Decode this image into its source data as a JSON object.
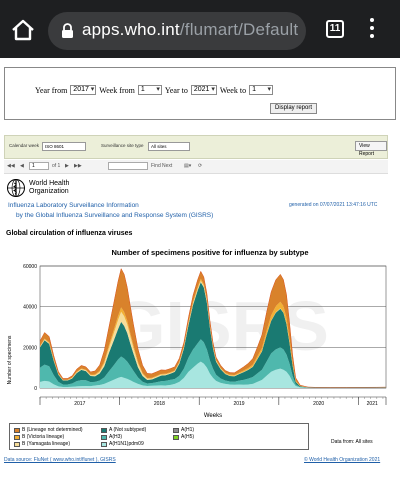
{
  "browser": {
    "url_host": "apps.who.int",
    "url_path": "/flumart/Default",
    "tab_count": "11"
  },
  "filters": {
    "year_from_label": "Year from",
    "year_from_value": "2017",
    "week_from_label": "Week from",
    "week_from_value": "1",
    "year_to_label": "Year to",
    "year_to_value": "2021",
    "week_to_label": "Week to",
    "week_to_value": "1",
    "display_button": "Display report"
  },
  "report_toolbar": {
    "calendar_label": "Calendar week",
    "calendar_value": "ISO 8601",
    "site_type_label": "Surveillance site type",
    "site_type_value": "All sites",
    "view_report_button": "View Report",
    "page_current": "1",
    "page_of": "of 1",
    "find_label": "Find",
    "next_label": "Next",
    "zoom_label": "Select a format"
  },
  "header": {
    "org_line1": "World Health",
    "org_line2": "Organization",
    "title": "Influenza Laboratory Surveillance Information",
    "subtitle": "by the Global Influenza Surveillance and Response System (GISRS)",
    "generated": "generated on 07/07/2021 13:47:16 UTC",
    "section": "Global circulation of influenza viruses"
  },
  "colors": {
    "b_lineage_not_determined": "#d9822b",
    "b_victoria": "#f2b035",
    "b_yamagata": "#f6dd9a",
    "a_not_subtyped": "#1a7a72",
    "a_h3": "#4fb8ad",
    "a_h1n1pdm09": "#a8e6e0",
    "a_h1": "#8c8c8c",
    "a_h5": "#7ed321",
    "bars": "#c8c8c8",
    "line": "#d94f1a",
    "title_blue": "#1f5fa8"
  },
  "chart_data": {
    "type": "area",
    "title": "Number of specimens positive for influenza by subtype",
    "xlabel": "Weeks",
    "ylabel": "Number of specimens",
    "ylim": [
      0,
      60000
    ],
    "yticks": [
      "0",
      "20000",
      "40000",
      "60000"
    ],
    "x_groups": [
      "2017",
      "2018",
      "2019",
      "2020",
      "2021"
    ],
    "watermark": "GISRS",
    "x": [
      0,
      3,
      6,
      9,
      12,
      15,
      18,
      21,
      24,
      27,
      30,
      33,
      36,
      39,
      42,
      45,
      48,
      51,
      53,
      55,
      57,
      59,
      61,
      64,
      67,
      70,
      73,
      76,
      79,
      82,
      85,
      88,
      91,
      94,
      97,
      100,
      103,
      105,
      107,
      109,
      111,
      113,
      115,
      118,
      121,
      124,
      127,
      130,
      133,
      136,
      139,
      142,
      145,
      148,
      151,
      154,
      157,
      159,
      161,
      163,
      165,
      167,
      170,
      175,
      180,
      190,
      200,
      210,
      220,
      226
    ],
    "series": [
      {
        "name": "A(H1N1)pdm09",
        "values": [
          3000,
          3500,
          3200,
          1800,
          800,
          500,
          500,
          600,
          800,
          900,
          1000,
          900,
          1200,
          1500,
          2000,
          3000,
          4000,
          5000,
          5500,
          5000,
          4500,
          3800,
          3000,
          2000,
          1300,
          1000,
          1100,
          1200,
          1300,
          1200,
          1500,
          2000,
          3000,
          5000,
          8000,
          10000,
          12000,
          13000,
          12000,
          10000,
          7000,
          5000,
          3500,
          2500,
          2000,
          1700,
          1600,
          1700,
          1600,
          1700,
          2000,
          3000,
          4000,
          6000,
          8000,
          9000,
          9500,
          9000,
          8000,
          6000,
          3000,
          1000,
          300,
          150,
          120,
          100,
          100,
          120,
          130,
          150
        ]
      },
      {
        "name": "A(H3)",
        "values": [
          7000,
          8000,
          7500,
          4500,
          2200,
          1200,
          1200,
          1600,
          2600,
          3000,
          2800,
          2000,
          1800,
          2200,
          3200,
          5200,
          7000,
          9000,
          10000,
          9500,
          8500,
          7000,
          5500,
          3200,
          1800,
          1200,
          1300,
          1600,
          2000,
          2300,
          2500,
          2400,
          3000,
          4500,
          7000,
          9000,
          10000,
          11000,
          10500,
          9000,
          6500,
          4500,
          3000,
          2200,
          1700,
          1500,
          1500,
          1900,
          2400,
          2900,
          3400,
          4200,
          5000,
          7000,
          9000,
          10000,
          10500,
          10000,
          8500,
          6000,
          3000,
          800,
          200,
          80,
          60,
          50,
          50,
          60,
          70,
          80
        ]
      },
      {
        "name": "A (Not subtyped)",
        "values": [
          10000,
          12000,
          11000,
          7000,
          3500,
          2000,
          2000,
          2500,
          4000,
          5000,
          4500,
          3000,
          2800,
          3500,
          5500,
          9000,
          12000,
          15000,
          17000,
          16000,
          14000,
          11000,
          8500,
          5000,
          2800,
          1800,
          1800,
          2300,
          2800,
          2800,
          3000,
          3500,
          6000,
          10000,
          16000,
          22000,
          26000,
          28000,
          27000,
          23000,
          16000,
          10000,
          6500,
          4500,
          3200,
          2700,
          2700,
          3200,
          3800,
          4300,
          5000,
          7000,
          9000,
          13000,
          16000,
          18000,
          19000,
          18000,
          15000,
          10000,
          5000,
          1200,
          300,
          100,
          80,
          70,
          80,
          90,
          100,
          120
        ]
      },
      {
        "name": "A(H1)",
        "values": [
          0,
          0,
          0,
          0,
          0,
          0,
          0,
          0,
          0,
          0,
          0,
          0,
          0,
          0,
          0,
          0,
          0,
          0,
          0,
          0,
          0,
          0,
          0,
          0,
          0,
          0,
          0,
          0,
          0,
          0,
          0,
          0,
          0,
          0,
          0,
          0,
          0,
          0,
          0,
          0,
          0,
          0,
          0,
          0,
          0,
          0,
          0,
          0,
          0,
          0,
          0,
          0,
          0,
          0,
          0,
          0,
          0,
          0,
          0,
          0,
          0,
          0,
          0,
          0,
          0,
          0,
          0,
          0,
          0,
          0
        ]
      },
      {
        "name": "A(H5)",
        "values": [
          0,
          0,
          0,
          0,
          0,
          0,
          0,
          0,
          0,
          0,
          0,
          0,
          0,
          0,
          0,
          0,
          0,
          0,
          0,
          0,
          0,
          0,
          0,
          0,
          0,
          0,
          0,
          0,
          0,
          0,
          0,
          0,
          0,
          0,
          0,
          0,
          0,
          0,
          0,
          0,
          0,
          0,
          0,
          0,
          0,
          0,
          0,
          0,
          0,
          0,
          0,
          0,
          0,
          0,
          0,
          0,
          0,
          0,
          0,
          0,
          0,
          0,
          0,
          0,
          0,
          0,
          0,
          0,
          0,
          0
        ]
      },
      {
        "name": "B (Yamagata lineage)",
        "values": [
          300,
          400,
          400,
          300,
          200,
          150,
          150,
          200,
          300,
          400,
          400,
          400,
          500,
          800,
          1500,
          2500,
          3500,
          4500,
          5000,
          4800,
          4200,
          3500,
          2800,
          1800,
          1000,
          600,
          500,
          500,
          500,
          400,
          400,
          400,
          400,
          500,
          600,
          700,
          800,
          800,
          700,
          600,
          500,
          400,
          300,
          250,
          200,
          200,
          200,
          200,
          200,
          200,
          200,
          200,
          200,
          200,
          200,
          200,
          200,
          200,
          200,
          150,
          100,
          50,
          20,
          10,
          5,
          5,
          5,
          5,
          5,
          5
        ]
      },
      {
        "name": "B (Victoria lineage)",
        "values": [
          300,
          400,
          400,
          300,
          200,
          150,
          150,
          200,
          300,
          300,
          300,
          300,
          400,
          500,
          800,
          1200,
          1600,
          2000,
          2200,
          2100,
          1800,
          1500,
          1200,
          800,
          500,
          300,
          300,
          300,
          300,
          300,
          300,
          300,
          400,
          500,
          700,
          800,
          900,
          900,
          900,
          800,
          600,
          500,
          400,
          400,
          400,
          400,
          400,
          500,
          600,
          700,
          900,
          1200,
          1500,
          2000,
          2600,
          3000,
          3200,
          3100,
          2800,
          2000,
          1200,
          500,
          150,
          50,
          30,
          30,
          30,
          30,
          30,
          30
        ]
      },
      {
        "name": "B (Lineage not determined)",
        "values": [
          2500,
          3000,
          2800,
          2000,
          1200,
          700,
          700,
          900,
          1300,
          1500,
          1400,
          1300,
          1700,
          2800,
          5500,
          9000,
          13000,
          17000,
          19000,
          18500,
          16500,
          13500,
          10500,
          6500,
          3800,
          2300,
          2000,
          2000,
          2000,
          1800,
          1800,
          1800,
          1800,
          2000,
          2500,
          3200,
          3600,
          3700,
          3500,
          3100,
          2500,
          2000,
          1500,
          1300,
          1100,
          1100,
          1100,
          1400,
          1800,
          2300,
          3000,
          4500,
          6500,
          9000,
          11500,
          13000,
          13500,
          13000,
          11500,
          8000,
          4000,
          1500,
          400,
          100,
          50,
          40,
          40,
          50,
          50,
          60
        ]
      }
    ],
    "legend": [
      "B (Lineage not determined)",
      "B (Victoria lineage)",
      "B (Yamagata lineage)",
      "A (Not subtyped)",
      "A(H3)",
      "A(H1N1)pdm09",
      "A(H1)",
      "A(H5)"
    ],
    "legend_placement": "bottom",
    "data_from": "Data from: All sites"
  },
  "footer": {
    "source": "Data source: FluNet ( www.who.int/flunet ), GISRS",
    "copyright": "© World Health Organization 2021"
  }
}
